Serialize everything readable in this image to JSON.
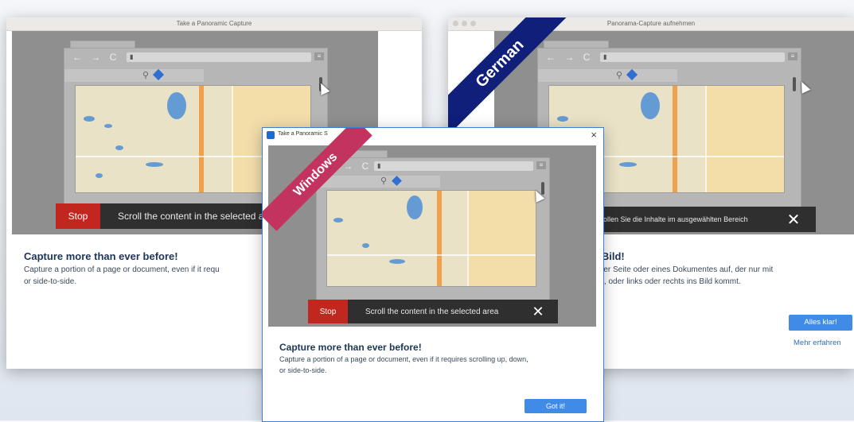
{
  "english": {
    "title": "Take a Panoramic Capture",
    "stop": "Stop",
    "scroll": "Scroll the content in the selected a",
    "heading": "Capture more than ever before!",
    "body_line1": "Capture a portion of a page or document, even if it requ",
    "body_line2": "or side-to-side."
  },
  "german": {
    "title": "Panorama-Capture aufnehmen",
    "ribbon": "German",
    "scroll": "rollen Sie die Inhalte im ausgewählten Bereich",
    "heading": "s Bild!",
    "body_line1": "einer Seite oder eines Dokumentes auf, der nur mit",
    "body_line2": "ten, oder links oder rechts ins Bild kommt.",
    "ok_button": "Alles klar!",
    "more_link": "Mehr erfahren"
  },
  "windows": {
    "title": "Take a Panoramic S",
    "ribbon": "Windows",
    "stop": "Stop",
    "scroll": "Scroll the content in the selected area",
    "heading": "Capture more than ever before!",
    "body_line1": "Capture a portion of a page or document, even if it requires scrolling up, down,",
    "body_line2": "or side-to-side.",
    "ok_button": "Got it!",
    "close": "×"
  },
  "icons": {
    "close": "✕",
    "nav": "← → C",
    "lock": "🔒",
    "menu": "≡",
    "search": "⚲"
  },
  "colors": {
    "stop_red": "#c1271f",
    "german_ribbon": "#0f1f7a",
    "windows_ribbon": "#c2345f",
    "button_blue": "#3f8be6"
  }
}
